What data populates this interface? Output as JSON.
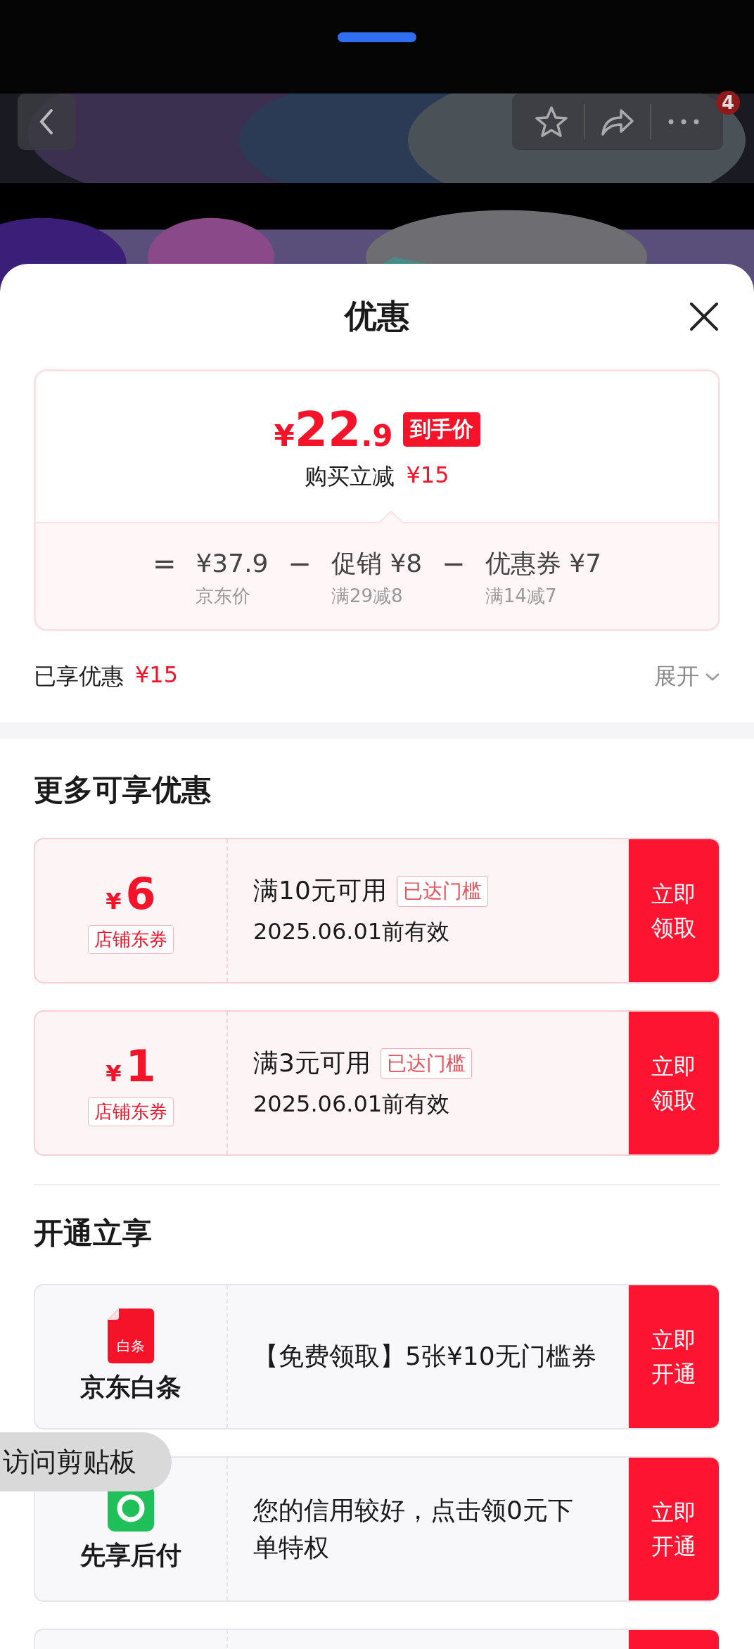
{
  "top_bar": {
    "badge": "4"
  },
  "sheet": {
    "title": "优惠"
  },
  "price_card": {
    "currency": "¥",
    "price_int": "22",
    "price_dec": ".9",
    "price_tag": "到手价",
    "saving_label": "购买立减",
    "saving_amount": "¥15",
    "breakdown": [
      {
        "operator": "=",
        "amount": "¥37.9",
        "note": "京东价"
      },
      {
        "operator": "−",
        "amount": "促销 ¥8",
        "note": "满29减8"
      },
      {
        "operator": "−",
        "amount": "优惠券 ¥7",
        "note": "满14减7"
      }
    ]
  },
  "summary": {
    "label": "已享优惠",
    "amount": "¥15",
    "toggle": "展开"
  },
  "coupons_section": {
    "title": "更多可享优惠",
    "coupons": [
      {
        "currency": "¥",
        "value": "6",
        "type": "店铺东券",
        "condition": "满10元可用",
        "tag": "已达门槛",
        "validity": "2025.06.01前有效",
        "action": "立即领取"
      },
      {
        "currency": "¥",
        "value": "1",
        "type": "店铺东券",
        "condition": "满3元可用",
        "tag": "已达门槛",
        "validity": "2025.06.01前有效",
        "action": "立即领取"
      }
    ]
  },
  "services_section": {
    "title": "开通立享",
    "services": [
      {
        "kind": "baitiao",
        "icon_text": "白条",
        "name": "京东白条",
        "description": "【免费领取】5张¥10无门槛券",
        "action": "立即开通"
      },
      {
        "kind": "paylater",
        "name": "先享后付",
        "description": "您的信用较好，点击领0元下单特权",
        "action": "立即开通"
      },
      {
        "kind": "blank"
      }
    ]
  },
  "toast": {
    "text": "访问剪贴板"
  }
}
